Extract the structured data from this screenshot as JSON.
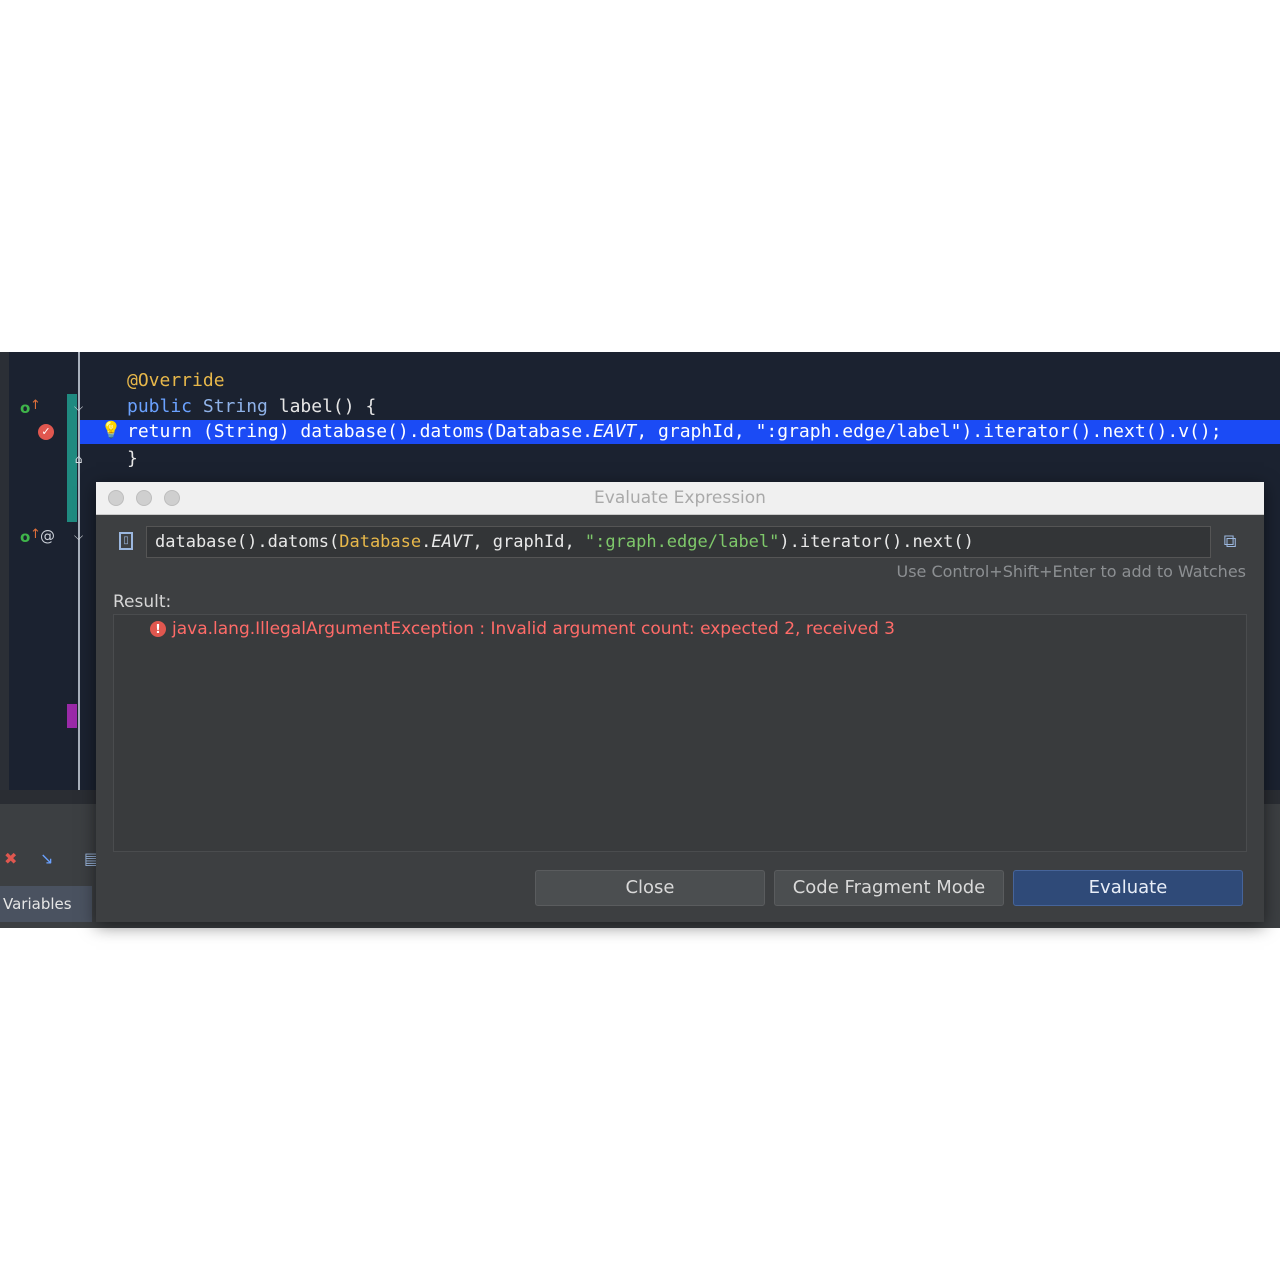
{
  "editor": {
    "lines": {
      "annotation": "@Override",
      "method_kw": "public",
      "method_type": "String",
      "method_rest": " label() {",
      "return_line_pre": "return (String) database().datoms(Database.",
      "return_line_italic": "EAVT",
      "return_line_post": ", graphId, \":graph.edge/label\").iterator().next().v();",
      "closing": "}"
    },
    "gutter_icons": {
      "override": "o-icon",
      "up_arrow": "up-arrow-icon",
      "at": "at-icon",
      "breakpoint": "breakpoint-icon",
      "bulb": "lightbulb-icon"
    }
  },
  "debug_panel": {
    "variables_tab": "Variables"
  },
  "dialog": {
    "title": "Evaluate Expression",
    "expression": {
      "pre": "database().datoms(",
      "class_ref": "Database",
      "dot": ".",
      "field": "EAVT",
      "mid": ", graphId, ",
      "string": "\":graph.edge/label\"",
      "post": ").iterator().next()"
    },
    "hint": "Use Control+Shift+Enter to add to Watches",
    "result_label": "Result:",
    "error": "java.lang.IllegalArgumentException : Invalid argument count: expected 2, received 3",
    "buttons": {
      "close": "Close",
      "code_fragment": "Code Fragment Mode",
      "evaluate": "Evaluate"
    }
  },
  "colors": {
    "editor_bg": "#1b2230",
    "highlight": "#1b4bf5",
    "annotation": "#e8b84a",
    "keyword": "#6aa1ff",
    "error": "#ff6b68",
    "evaluate_button": "#2f4a78"
  }
}
